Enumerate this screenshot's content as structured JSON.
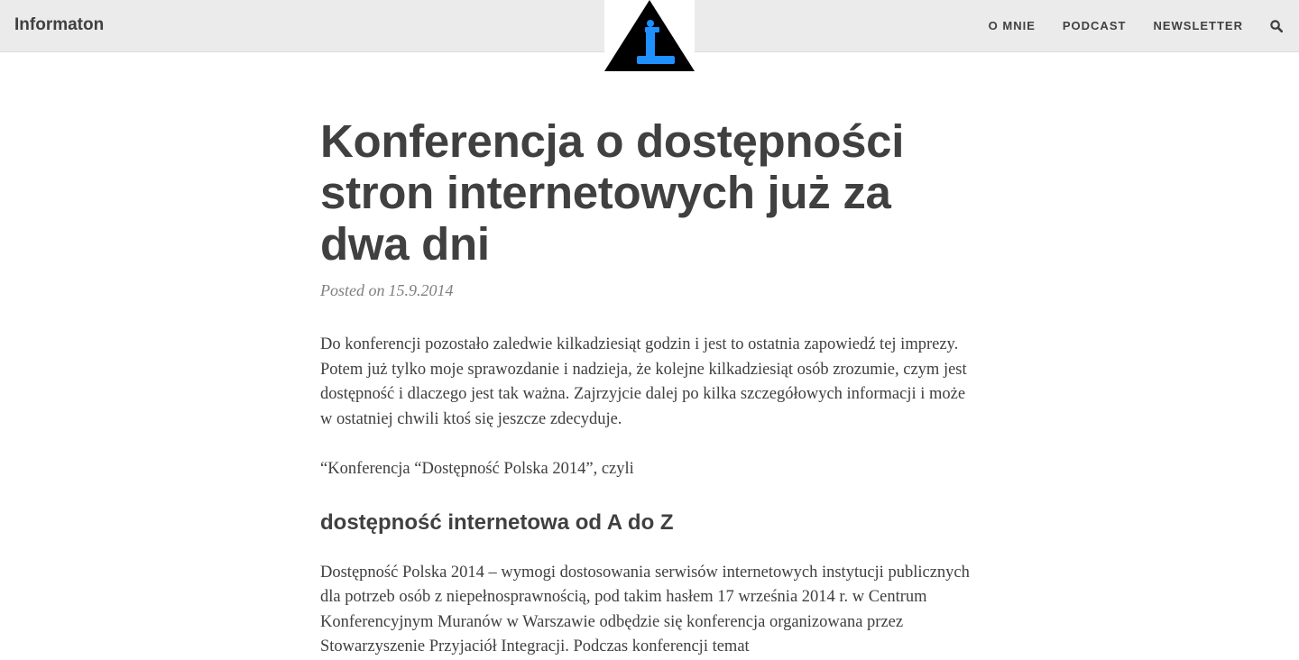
{
  "header": {
    "brand": "Informaton",
    "nav": [
      {
        "label": "O MNIE"
      },
      {
        "label": "PODCAST"
      },
      {
        "label": "NEWSLETTER"
      }
    ],
    "search_icon": "search-icon",
    "logo_icon": "info-triangle-logo",
    "colors": {
      "bar": "#ebebeb",
      "logo_triangle": "#000000",
      "logo_i": "#1e90ff"
    }
  },
  "article": {
    "title": "Konferencja o dostępności stron internetowych już za dwa dni",
    "posted_label": "Posted on",
    "date": "15.9.2014",
    "paragraph1": "Do konferencji pozostało zaledwie kilkadziesiąt godzin i jest to ostatnia zapowiedź tej imprezy. Potem już tylko moje sprawozdanie i nadzieja, że kolejne kilkadziesiąt osób zrozumie, czym jest dostępność i dlaczego jest tak ważna. Zajrzyjcie dalej po kilka szczegółowych informacji i może w ostatniej chwili ktoś się jeszcze zdecyduje.",
    "paragraph2": "“Konferencja “Dostępność Polska 2014”, czyli",
    "subheading": "dostępność internetowa od A do Z",
    "paragraph3": "Dostępność Polska 2014 – wymogi dostosowania serwisów internetowych instytucji publicznych dla potrzeb osób z niepełnosprawnością, pod takim hasłem 17 września 2014 r. w Centrum Konferencyjnym Muranów w Warszawie odbędzie się konferencja organizowana przez Stowarzyszenie Przyjaciół Integracji. Podczas konferencji temat"
  }
}
